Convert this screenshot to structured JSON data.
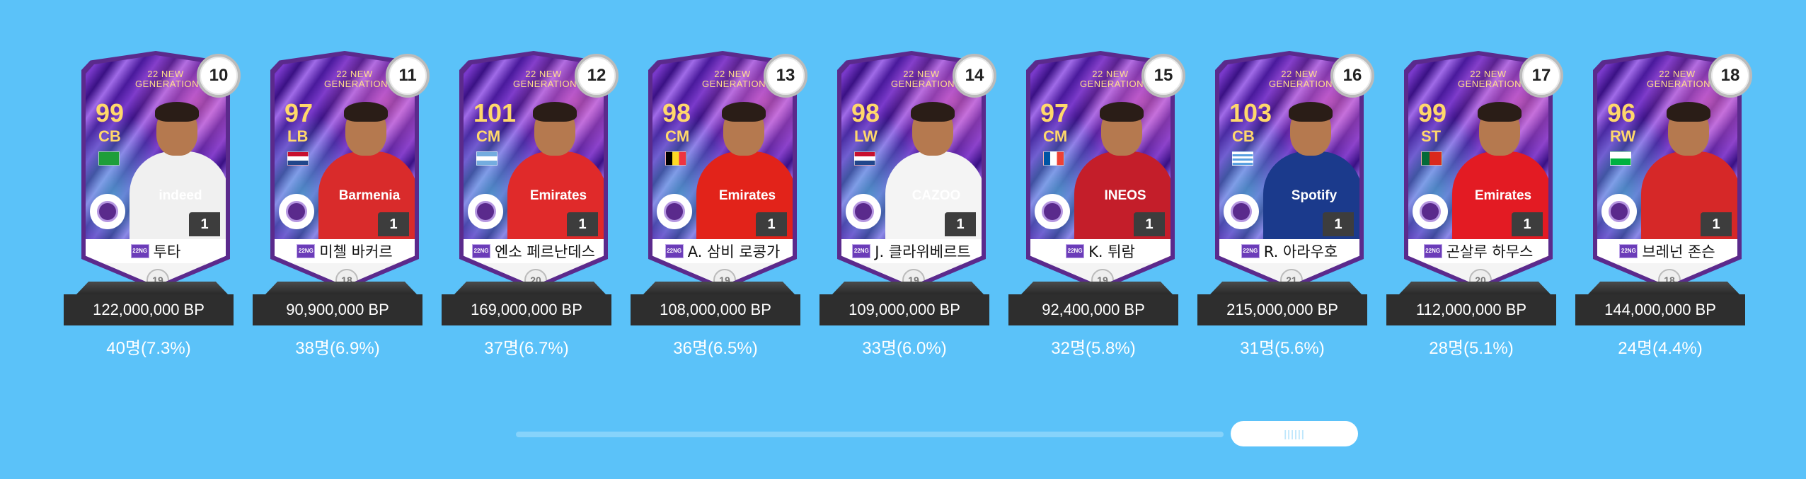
{
  "colors": {
    "background": "#5bc2f9",
    "card_frame": "#5b2a8c",
    "price_bar": "#2e2e2e",
    "scroll_track": "#86d3fb"
  },
  "cards": [
    {
      "rank": "10",
      "title": "22 NEW\nGENERATION",
      "ovr": "99",
      "pos": "CB",
      "name": "투타",
      "level": "1",
      "grade": "19",
      "price": "122,000,000 BP",
      "count": "40명(7.3%)",
      "kit": "#f0f0f0",
      "sponsor": "indeed",
      "flag": "brazil"
    },
    {
      "rank": "11",
      "title": "22 NEW\nGENERATION",
      "ovr": "97",
      "pos": "LB",
      "name": "미첼 바커르",
      "level": "1",
      "grade": "18",
      "price": "90,900,000 BP",
      "count": "38명(6.9%)",
      "kit": "#d92b2b",
      "sponsor": "Barmenia",
      "flag": "netherlands"
    },
    {
      "rank": "12",
      "title": "22 NEW\nGENERATION",
      "ovr": "101",
      "pos": "CM",
      "name": "엔소 페르난데스",
      "level": "1",
      "grade": "20",
      "price": "169,000,000 BP",
      "count": "37명(6.7%)",
      "kit": "#e02a2a",
      "sponsor": "Emirates",
      "flag": "argentina"
    },
    {
      "rank": "13",
      "title": "22 NEW\nGENERATION",
      "ovr": "98",
      "pos": "CM",
      "name": "A. 삼비 로콩가",
      "level": "1",
      "grade": "19",
      "price": "108,000,000 BP",
      "count": "36명(6.5%)",
      "kit": "#e2231a",
      "sponsor": "Emirates",
      "flag": "belgium"
    },
    {
      "rank": "14",
      "title": "22 NEW\nGENERATION",
      "ovr": "98",
      "pos": "LW",
      "name": "J. 클라위베르트",
      "level": "1",
      "grade": "19",
      "price": "109,000,000 BP",
      "count": "33명(6.0%)",
      "kit": "#f4f4f4",
      "sponsor": "CAZOO",
      "flag": "netherlands"
    },
    {
      "rank": "15",
      "title": "22 NEW\nGENERATION",
      "ovr": "97",
      "pos": "CM",
      "name": "K. 튀람",
      "level": "1",
      "grade": "19",
      "price": "92,400,000 BP",
      "count": "32명(5.8%)",
      "kit": "#c41e2a",
      "sponsor": "INEOS",
      "flag": "france"
    },
    {
      "rank": "16",
      "title": "22 NEW\nGENERATION",
      "ovr": "103",
      "pos": "CB",
      "name": "R. 아라우호",
      "level": "1",
      "grade": "21",
      "price": "215,000,000 BP",
      "count": "31명(5.6%)",
      "kit": "#1b3a8c",
      "sponsor": "Spotify",
      "flag": "uruguay"
    },
    {
      "rank": "17",
      "title": "22 NEW\nGENERATION",
      "ovr": "99",
      "pos": "ST",
      "name": "곤살루 하무스",
      "level": "1",
      "grade": "20",
      "price": "112,000,000 BP",
      "count": "28명(5.1%)",
      "kit": "#e31b23",
      "sponsor": "Emirates",
      "flag": "portugal"
    },
    {
      "rank": "18",
      "title": "22 NEW\nGENERATION",
      "ovr": "96",
      "pos": "RW",
      "name": "브레넌 존슨",
      "level": "1",
      "grade": "18",
      "price": "144,000,000 BP",
      "count": "24명(4.4%)",
      "kit": "#d62828",
      "sponsor": "",
      "flag": "wales"
    }
  ],
  "season_icon_text": "22NG",
  "scrollbar": {
    "grip": "||||||"
  }
}
